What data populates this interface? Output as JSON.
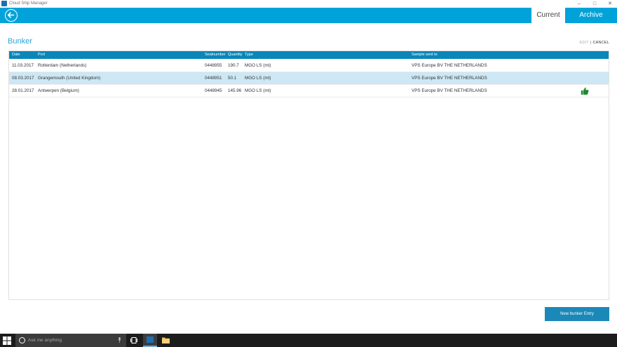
{
  "window": {
    "title": "Cloud Ship Manager",
    "controls": {
      "minimize": "–",
      "maximize": "□",
      "close": "✕"
    }
  },
  "header": {
    "tabs": [
      {
        "label": "Current",
        "active": true
      },
      {
        "label": "Archive",
        "active": false
      }
    ]
  },
  "page": {
    "title": "Bunker",
    "edit_label": "EDIT",
    "separator": "|",
    "cancel_label": "CANCEL"
  },
  "table": {
    "columns": {
      "date": "Date",
      "port": "Port",
      "seal": "Sealnumber",
      "qty": "Quantity",
      "type": "Type",
      "sample": "Sample sent to"
    },
    "rows": [
      {
        "date": "11.03.2017",
        "port": "Rotterdam (Netherlands)",
        "seal": "0448955",
        "qty": "190.7",
        "type": "MGO LS (mt)",
        "sample": "VPS Europe BV THE NETHERLANDS",
        "selected": false,
        "approved": false
      },
      {
        "date": "08.03.2017",
        "port": "Grangemouth (United Kingdom)",
        "seal": "0448951",
        "qty": "50.1",
        "type": "MGO LS (mt)",
        "sample": "VPS Europe BV THE NETHERLANDS",
        "selected": true,
        "approved": false
      },
      {
        "date": "28.01.2017",
        "port": "Antwerpen (Belgium)",
        "seal": "0448945",
        "qty": "145.96",
        "type": "MGO LS (mt)",
        "sample": "VPS Europe BV THE NETHERLANDS",
        "selected": false,
        "approved": true
      }
    ]
  },
  "actions": {
    "new_entry": "New bunker Entry"
  },
  "taskbar": {
    "search_placeholder": "Ask me anything"
  },
  "colors": {
    "header": "#00a3d9",
    "table_header": "#0b86b8",
    "selected_row": "#cde8f4",
    "button": "#1b88b8",
    "approved_icon": "#1e8a2e"
  },
  "icons": {
    "back": "back-arrow-icon",
    "approved": "thumbs-up-icon",
    "start": "windows-start-icon",
    "search": "cortana-circle-icon",
    "mic": "microphone-icon",
    "taskview": "task-view-icon",
    "folder": "file-explorer-icon"
  }
}
